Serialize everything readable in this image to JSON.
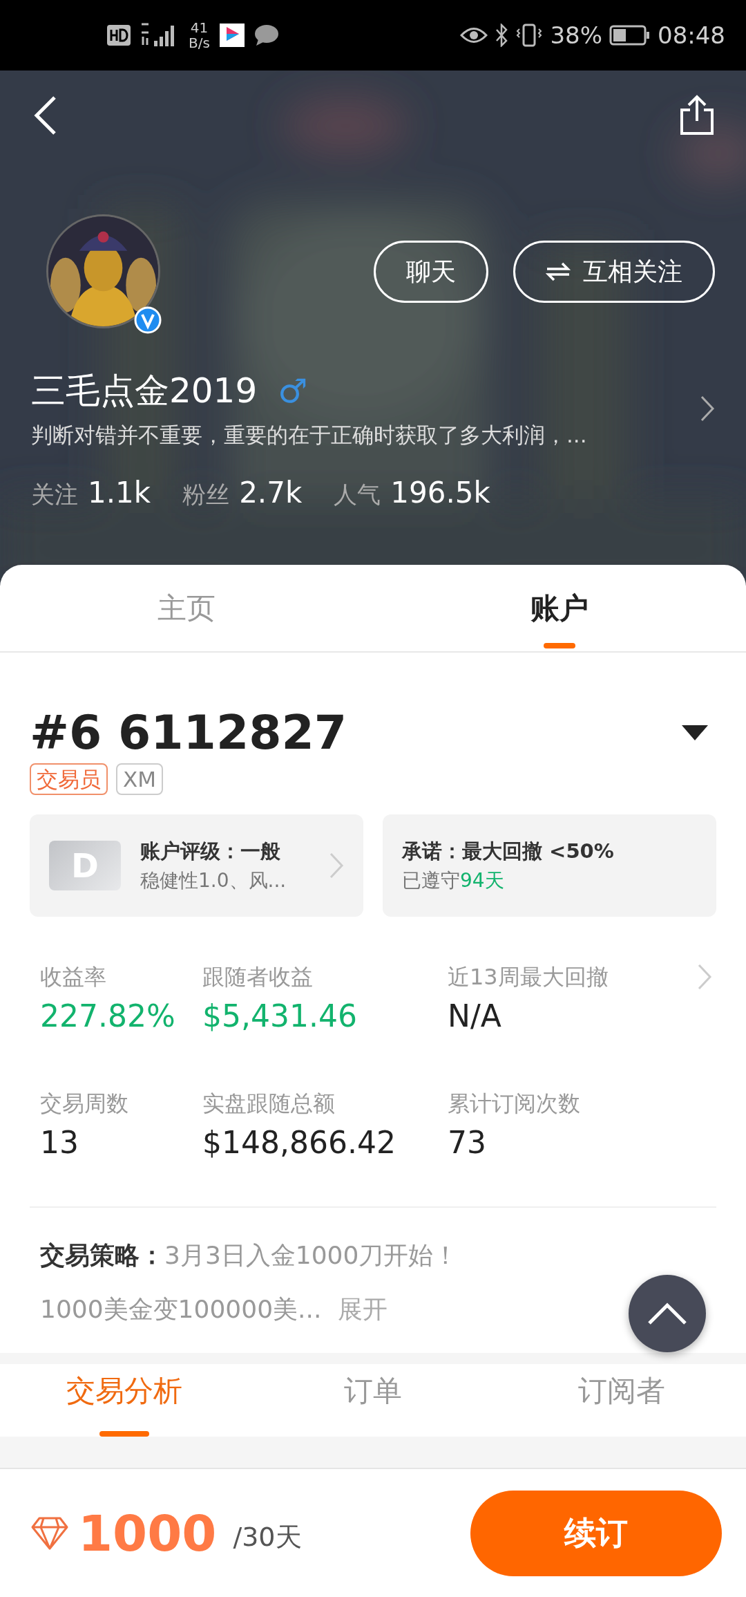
{
  "status_bar": {
    "speed_value": "41",
    "speed_unit": "B/s",
    "battery_percent": "38%",
    "time": "08:48"
  },
  "profile": {
    "name": "三毛点金2019",
    "gender_symbol": "♂",
    "verified": true,
    "bio": "判断对错并不重要，重要的在于正确时获取了多大利润，...",
    "buttons": [
      {
        "label": "聊天",
        "kind": "chat"
      },
      {
        "label": "互相关注",
        "kind": "mutual"
      }
    ],
    "stats": [
      {
        "label": "关注",
        "value": "1.1k"
      },
      {
        "label": "粉丝",
        "value": "2.7k"
      },
      {
        "label": "人气",
        "value": "196.5k"
      }
    ]
  },
  "tabs": [
    {
      "label": "主页",
      "selected": false
    },
    {
      "label": "账户",
      "selected": true
    }
  ],
  "account": {
    "number": "#6 6112827",
    "tags": [
      {
        "label": "交易员",
        "kind": "role"
      },
      {
        "label": "XM",
        "kind": "broker"
      }
    ],
    "rating_card": {
      "grade": "D",
      "title": "账户评级：一般",
      "detail": "稳健性1.0、风..."
    },
    "promise_card": {
      "title": "承诺：最大回撤 <50%",
      "detail": "已遵守",
      "days": "94天"
    }
  },
  "metrics": [
    {
      "label": "收益率",
      "value": "227.82%",
      "kind": "gain"
    },
    {
      "label": "跟随者收益",
      "value": "$5,431.46",
      "kind": "gain"
    },
    {
      "label": "近13周最大回撤",
      "value": "N/A",
      "kind": "plain"
    },
    {
      "label": "交易周数",
      "value": "13",
      "kind": "plain"
    },
    {
      "label": "实盘跟随总额",
      "value": "$148,866.42",
      "kind": "plain"
    },
    {
      "label": "累计订阅次数",
      "value": "73",
      "kind": "plain"
    }
  ],
  "strategy": {
    "label": "交易策略：",
    "text": "3月3日入金1000刀开始！",
    "excerpt": "1000美金变100000美...",
    "expand": "展开"
  },
  "sub_tabs": [
    {
      "label": "交易分析",
      "selected": true
    },
    {
      "label": "订单",
      "selected": false
    },
    {
      "label": "订阅者",
      "selected": false
    }
  ],
  "subscription": {
    "price": "1000",
    "period": "/30天",
    "button": "续订"
  }
}
